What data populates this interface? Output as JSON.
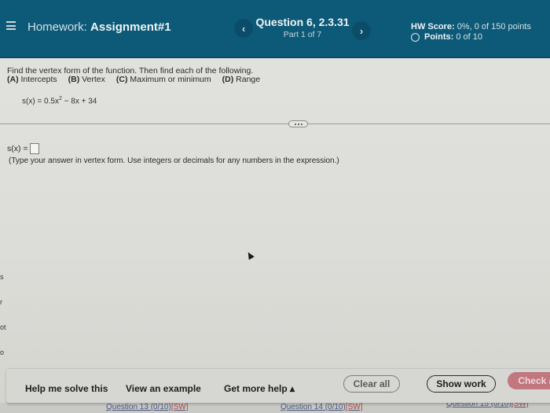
{
  "header": {
    "menu_icon": "hamburger-menu-icon",
    "homework_label": "Homework:",
    "assignment_name": "Assignment#1",
    "prev_icon": "‹",
    "next_icon": "›",
    "question_title": "Question 6, 2.3.31",
    "question_part": "Part 1 of 7",
    "hw_score_label": "HW Score:",
    "hw_score_value": "0%, 0 of 150 points",
    "points_label": "Points:",
    "points_value": "0 of 10"
  },
  "question": {
    "prompt": "Find the vertex form of the function.  Then find each of the following.",
    "parts": [
      {
        "letter": "(A)",
        "label": "Intercepts"
      },
      {
        "letter": "(B)",
        "label": "Vertex"
      },
      {
        "letter": "(C)",
        "label": "Maximum or minimum"
      },
      {
        "letter": "(D)",
        "label": "Range"
      }
    ],
    "function_lhs": "s(x) = 0.5x",
    "function_exp": "2",
    "function_rhs": " − 8x + 34",
    "more_icon": "ellipsis-icon",
    "answer_label": "s(x) =",
    "answer_value": "",
    "hint": "(Type your answer in vertex form. Use integers or decimals for any numbers in the expression.)"
  },
  "edge_glyphs": [
    "s",
    "r",
    "ot",
    "o"
  ],
  "footer": {
    "help_me_solve": "Help me solve this",
    "view_example": "View an example",
    "get_more_help": "Get more help",
    "get_more_help_caret": "▴",
    "clear_all": "Clear all",
    "show_work": "Show work",
    "check_answer": "Check an"
  },
  "background_links": [
    {
      "label": "Question 13 (0/10)",
      "tag": "[SW]"
    },
    {
      "label": "Question 14 (0/10)",
      "tag": "[SW]"
    },
    {
      "label": "Question 15 (0/10)",
      "tag": "[SW]"
    }
  ],
  "colors": {
    "header_bg": "#0d5a78",
    "check_answer_bg": "#c2767e",
    "page_bg": "#e0e0dd"
  }
}
